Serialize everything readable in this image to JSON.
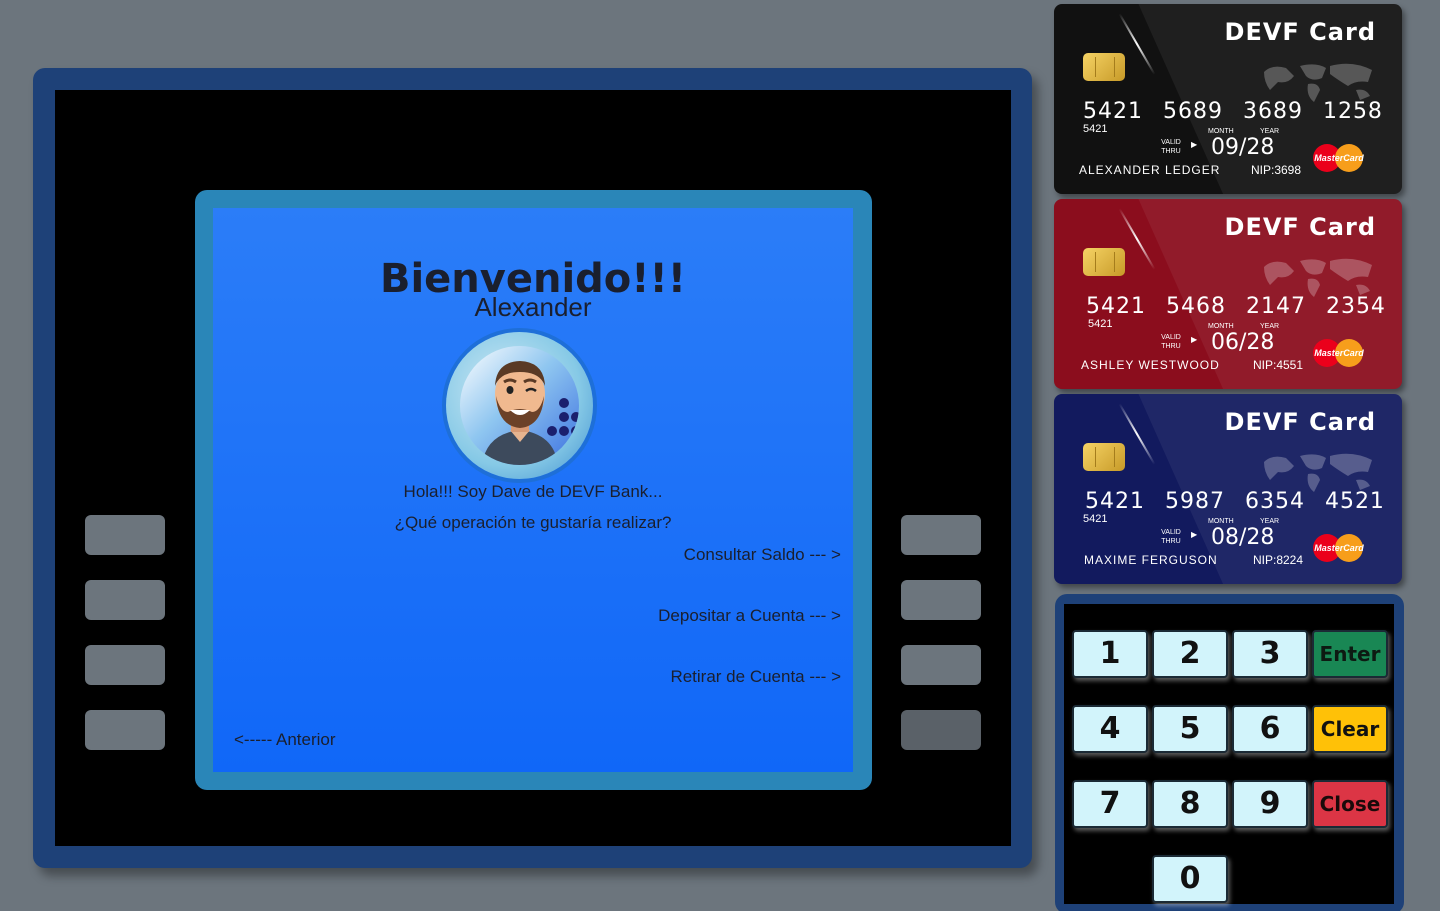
{
  "screen": {
    "title": "Bienvenido!!!",
    "username": "Alexander",
    "message1": "Hola!!! Soy Dave de DEVF Bank...",
    "message2": "¿Qué operación te gustaría realizar?",
    "options": [
      "Consultar Saldo --- >",
      "Depositar a Cuenta --- >",
      "Retirar de Cuenta --- >"
    ],
    "back": "<----- Anterior"
  },
  "cards": [
    {
      "brand": "DEVF Card",
      "number": "5421 5689 3689 1258",
      "prefix": "5421",
      "valid": "VALID THRU",
      "month_label": "MONTH",
      "year_label": "YEAR",
      "expiry": "09/28",
      "holder": "ALEXANDER LEDGER",
      "nip": "NIP:3698",
      "network": "MasterCard",
      "color": "#111111"
    },
    {
      "brand": "DEVF Card",
      "number": "5421 5468 2147 2354",
      "prefix": "5421",
      "valid": "VALID THRU",
      "month_label": "MONTH",
      "year_label": "YEAR",
      "expiry": "06/28",
      "holder": "ASHLEY WESTWOOD",
      "nip": "NIP:4551",
      "network": "MasterCard",
      "color": "#8b0d1d"
    },
    {
      "brand": "DEVF Card",
      "number": "5421 5987 6354 4521",
      "prefix": "5421",
      "valid": "VALID THRU",
      "month_label": "MONTH",
      "year_label": "YEAR",
      "expiry": "08/28",
      "holder": "MAXIME FERGUSON",
      "nip": "NIP:8224",
      "network": "MasterCard",
      "color": "#121a5e"
    }
  ],
  "keypad": {
    "keys": [
      "1",
      "2",
      "3",
      "4",
      "5",
      "6",
      "7",
      "8",
      "9",
      "0"
    ],
    "enter": "Enter",
    "clear": "Clear",
    "close": "Close"
  }
}
